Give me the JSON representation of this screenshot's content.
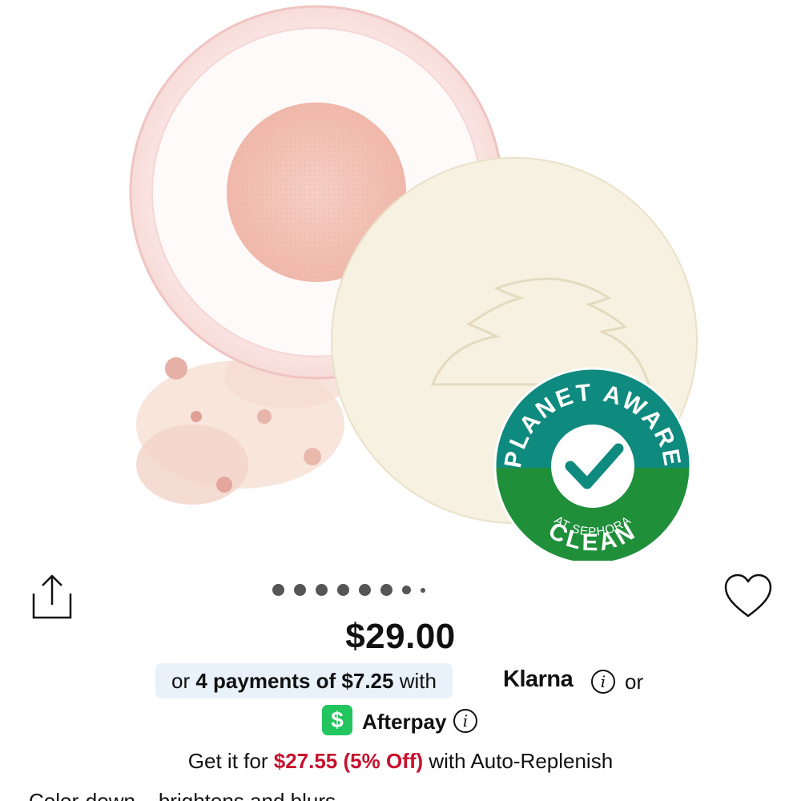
{
  "badge": {
    "top_text": "PLANET AWARE",
    "bottom_small": "AT SEPHORA",
    "bottom_text": "CLEAN",
    "top_color": "#0f8a7e",
    "bottom_color": "#1f8f3a"
  },
  "carousel": {
    "dot_count": 8,
    "active_index": 0
  },
  "price": "$29.00",
  "klarna": {
    "prefix": "or",
    "amount_text": "4 payments of $7.25",
    "suffix": "with",
    "brand": "Klarna",
    "info_icon": "info-icon",
    "trailing": "or"
  },
  "afterpay": {
    "logo_glyph": "$",
    "brand": "Afterpay",
    "info_icon": "info-icon",
    "brand_color": "#22c55e"
  },
  "replenish": {
    "prefix": "Get it for",
    "sale_price": "$27.55 (5% Off)",
    "suffix": "with Auto-Replenish",
    "sale_color": "#c8102e"
  },
  "description_partial": "Color-down... brightens and blurs"
}
